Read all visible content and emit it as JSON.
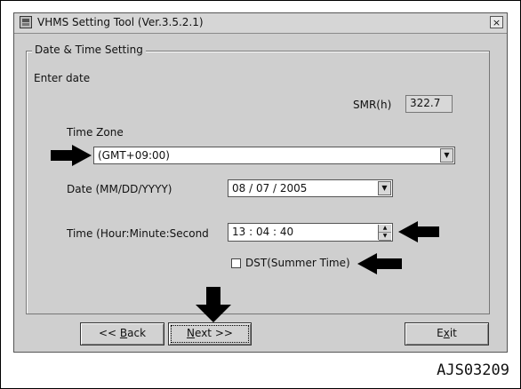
{
  "window": {
    "title": "VHMS Setting Tool  (Ver.3.5.2.1)",
    "close_label": "×"
  },
  "group": {
    "label": "Date & Time Setting",
    "instruction": "Enter date"
  },
  "smr": {
    "label": "SMR(h)",
    "value": "322.7"
  },
  "timezone": {
    "label": "Time Zone",
    "value": "(GMT+09:00)"
  },
  "date": {
    "label": "Date (MM/DD/YYYY)",
    "value": "08 / 07 / 2005"
  },
  "time": {
    "label": "Time (Hour:Minute:Second",
    "value": "13 : 04 : 40"
  },
  "dst": {
    "label": "DST(Summer Time)",
    "checked": false
  },
  "buttons": {
    "back_prefix": "<< ",
    "back_key": "B",
    "back_rest": "ack",
    "next_key": "N",
    "next_rest": "ext >>",
    "exit_prefix": "E",
    "exit_key": "x",
    "exit_rest": "it"
  },
  "figure_ref": "AJS03209",
  "colors": {
    "dialog_bg": "#cfcfcf",
    "arrow": "#000000",
    "field_bg": "#ffffff"
  }
}
